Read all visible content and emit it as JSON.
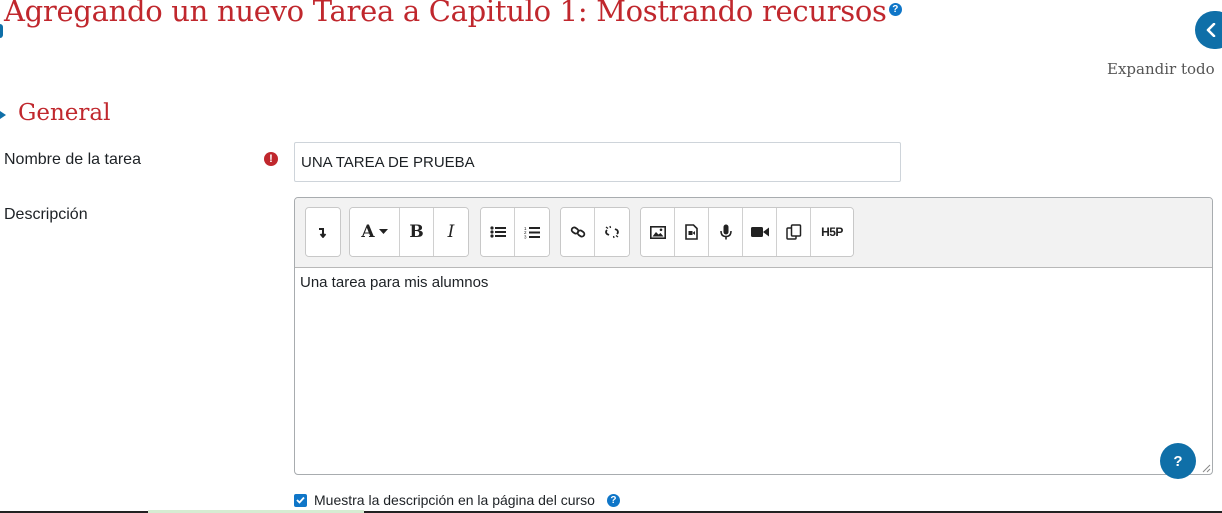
{
  "page": {
    "title": "Agregando un nuevo Tarea a Capitulo 1: Mostrando recursos",
    "title_help": "?",
    "expand_all": "Expandir todo"
  },
  "section": {
    "title": "General"
  },
  "form": {
    "name_label": "Nombre de la tarea",
    "name_value": "UNA TAREA DE PRUEBA",
    "required_icon": "!",
    "description_label": "Descripción",
    "description_text": "Una tarea para mis alumnos",
    "show_description_label": "Muestra la descripción en la página del curso",
    "show_description_checked": true
  },
  "toolbar": {
    "groups": [
      [
        "collapse-toolbar-icon"
      ],
      [
        "font-style-icon",
        "bold-icon",
        "italic-icon"
      ],
      [
        "unordered-list-icon",
        "ordered-list-icon"
      ],
      [
        "link-icon",
        "unlink-icon"
      ],
      [
        "image-icon",
        "media-icon",
        "record-audio-icon",
        "record-video-icon",
        "manage-files-icon",
        "h5p-icon"
      ]
    ],
    "font_label": "A",
    "bold_label": "B",
    "italic_label": "I",
    "h5p_label": "H5P"
  },
  "help_button": "?",
  "colors": {
    "title": "#c0272d",
    "accent": "#0f6fa8",
    "required": "#c0272d"
  }
}
